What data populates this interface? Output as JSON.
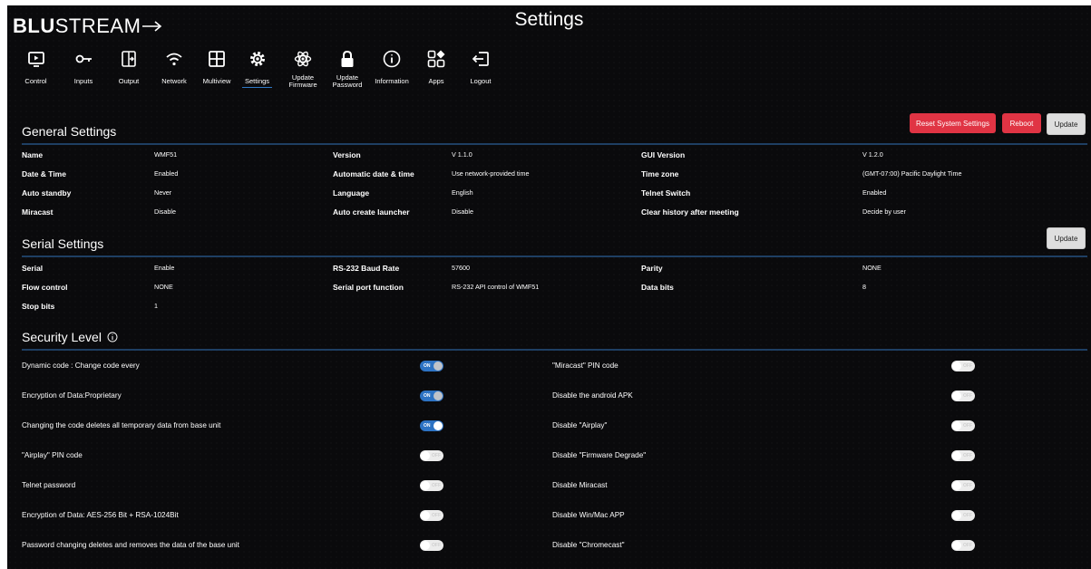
{
  "brand": {
    "logo_bold": "BLU",
    "logo_light": "STREAM"
  },
  "page_title": "Settings",
  "nav": [
    {
      "label": "Control",
      "icon": "monitor-play-icon"
    },
    {
      "label": "Inputs",
      "icon": "input-plug-icon"
    },
    {
      "label": "Output",
      "icon": "output-icon"
    },
    {
      "label": "Network",
      "icon": "wifi-icon"
    },
    {
      "label": "Multiview",
      "icon": "multiview-grid-icon"
    },
    {
      "label": "Settings",
      "icon": "gear-icon",
      "active": true
    },
    {
      "label": "Update Firmware",
      "icon": "atom-icon"
    },
    {
      "label": "Update Password",
      "icon": "lock-icon"
    },
    {
      "label": "Information",
      "icon": "info-icon"
    },
    {
      "label": "Apps",
      "icon": "apps-icon"
    },
    {
      "label": "Logout",
      "icon": "logout-icon"
    }
  ],
  "general": {
    "title": "General Settings",
    "buttons": {
      "reset": "Reset System Settings",
      "reboot": "Reboot",
      "update": "Update"
    },
    "rows": [
      [
        [
          "Name",
          "WMF51"
        ],
        [
          "Version",
          "V 1.1.0"
        ],
        [
          "GUI Version",
          "V 1.2.0"
        ]
      ],
      [
        [
          "Date & Time",
          "Enabled"
        ],
        [
          "Automatic date & time",
          "Use network-provided time"
        ],
        [
          "Time zone",
          "(GMT-07:00) Pacific Daylight Time"
        ]
      ],
      [
        [
          "Auto standby",
          "Never"
        ],
        [
          "Language",
          "English"
        ],
        [
          "Telnet Switch",
          "Enabled"
        ]
      ],
      [
        [
          "Miracast",
          "Disable"
        ],
        [
          "Auto create launcher",
          "Disable"
        ],
        [
          "Clear history after meeting",
          "Decide by user"
        ]
      ]
    ]
  },
  "serial": {
    "title": "Serial Settings",
    "update": "Update",
    "rows": [
      [
        [
          "Serial",
          "Enable"
        ],
        [
          "RS-232 Baud Rate",
          "57600"
        ],
        [
          "Parity",
          "NONE"
        ]
      ],
      [
        [
          "Flow control",
          "NONE"
        ],
        [
          "Serial port function",
          "RS-232 API control of WMF51"
        ],
        [
          "Data bits",
          "8"
        ]
      ],
      [
        [
          "Stop bits",
          "1"
        ]
      ]
    ]
  },
  "security": {
    "title": "Security Level",
    "on_text": "ON",
    "off_text": "OFF",
    "left": [
      {
        "label": "Dynamic code : Change code every",
        "on": true
      },
      {
        "label": "Encryption of Data:Proprietary",
        "on": true
      },
      {
        "label": "Changing the code deletes all temporary data from base unit",
        "on": true,
        "bright": true
      },
      {
        "label": "\"Airplay\" PIN code",
        "on": false
      },
      {
        "label": "Telnet password",
        "on": false
      },
      {
        "label": "Encryption of Data: AES-256 Bit + RSA-1024Bit",
        "on": false
      },
      {
        "label": "Password changing deletes and removes the data of the base unit",
        "on": false
      }
    ],
    "right": [
      {
        "label": "\"Miracast\" PIN code",
        "on": false
      },
      {
        "label": "Disable the android APK",
        "on": false
      },
      {
        "label": "Disable \"Airplay\"",
        "on": false
      },
      {
        "label": "Disable \"Firmware Degrade\"",
        "on": false
      },
      {
        "label": "Disable Miracast",
        "on": false
      },
      {
        "label": "Disable Win/Mac APP",
        "on": false
      },
      {
        "label": "Disable \"Chromecast\"",
        "on": false
      }
    ]
  },
  "colors": {
    "accent": "#2d73c4",
    "danger": "#e03444",
    "background": "#0a0a0c",
    "rule": "#1e3f63"
  }
}
